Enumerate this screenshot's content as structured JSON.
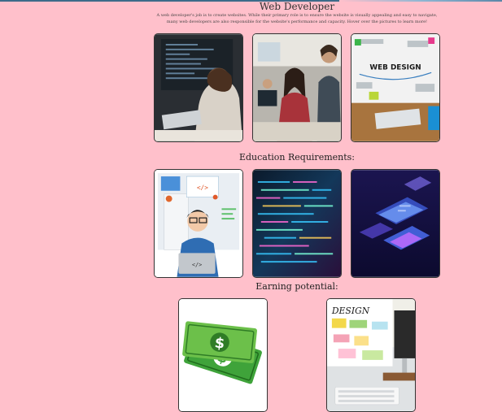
{
  "page": {
    "title": "Web Developer",
    "description": "A web developer's job is to create websites. While their primary role is to ensure the website is visually appealing and easy to navigate, many web developers are also responsible for the website's performance and capacity. Hover over the pictures to learn more!"
  },
  "sections": {
    "education": {
      "heading": "Education Requirements:"
    },
    "earning": {
      "heading": "Earning potential:"
    }
  },
  "images": {
    "webdesign_label": "WEB DESIGN",
    "code_tag": "</>",
    "code_tag2": "</>",
    "dollar": "$",
    "design_label": "DESIGN"
  },
  "colors": {
    "background": "#ffc0cb",
    "text": "#333333",
    "card_border": "#333333"
  }
}
